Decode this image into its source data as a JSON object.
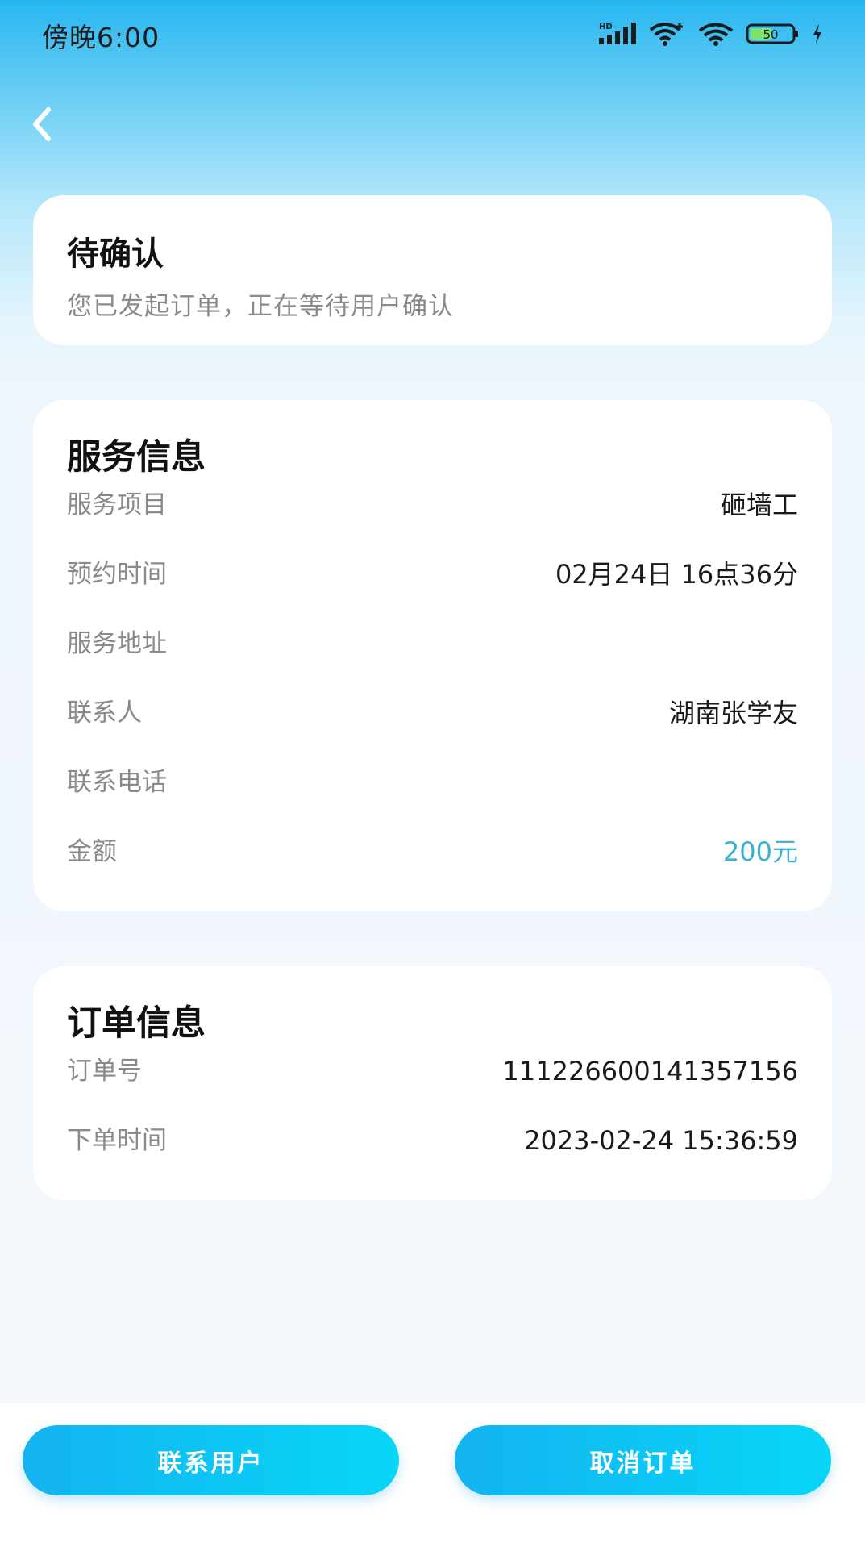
{
  "status_bar": {
    "time": "傍晚6:00",
    "battery": "50",
    "signal_label": "HD",
    "icons": [
      "signal-icon",
      "wifi-plus-icon",
      "wifi-icon",
      "battery-icon",
      "charging-icon"
    ]
  },
  "colors": {
    "accent": "#14b3f0",
    "amount": "#3db0d3",
    "header_gradient_top": "#27b6f0"
  },
  "status_card": {
    "title": "待确认",
    "description": "您已发起订单，正在等待用户确认"
  },
  "service_info": {
    "title": "服务信息",
    "rows": [
      {
        "label": "服务项目",
        "value": "砸墙工"
      },
      {
        "label": "预约时间",
        "value": "02月24日 16点36分"
      },
      {
        "label": "服务地址",
        "value": ""
      },
      {
        "label": "联系人",
        "value": "湖南张学友"
      },
      {
        "label": "联系电话",
        "value": ""
      },
      {
        "label": "金额",
        "value": "200元"
      }
    ]
  },
  "order_info": {
    "title": "订单信息",
    "rows": [
      {
        "label": "订单号",
        "value": "111226600141357156"
      },
      {
        "label": "下单时间",
        "value": "2023-02-24 15:36:59"
      }
    ]
  },
  "actions": {
    "contact_label": "联系用户",
    "cancel_label": "取消订单"
  }
}
